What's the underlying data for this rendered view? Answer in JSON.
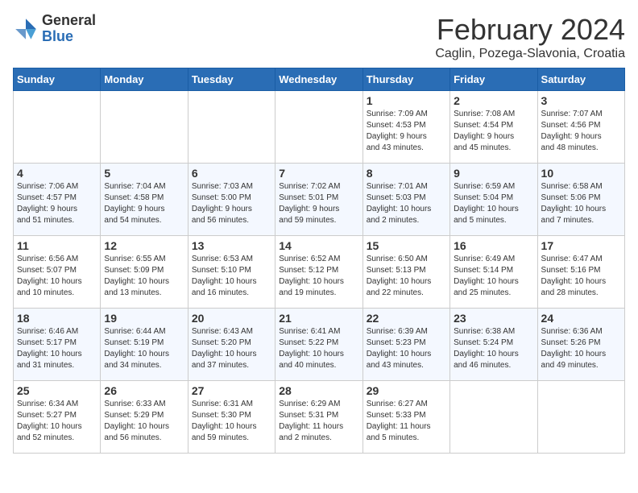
{
  "header": {
    "logo_general": "General",
    "logo_blue": "Blue",
    "month_year": "February 2024",
    "location": "Caglin, Pozega-Slavonia, Croatia"
  },
  "calendar": {
    "days_of_week": [
      "Sunday",
      "Monday",
      "Tuesday",
      "Wednesday",
      "Thursday",
      "Friday",
      "Saturday"
    ],
    "weeks": [
      [
        {
          "day": "",
          "info": ""
        },
        {
          "day": "",
          "info": ""
        },
        {
          "day": "",
          "info": ""
        },
        {
          "day": "",
          "info": ""
        },
        {
          "day": "1",
          "info": "Sunrise: 7:09 AM\nSunset: 4:53 PM\nDaylight: 9 hours\nand 43 minutes."
        },
        {
          "day": "2",
          "info": "Sunrise: 7:08 AM\nSunset: 4:54 PM\nDaylight: 9 hours\nand 45 minutes."
        },
        {
          "day": "3",
          "info": "Sunrise: 7:07 AM\nSunset: 4:56 PM\nDaylight: 9 hours\nand 48 minutes."
        }
      ],
      [
        {
          "day": "4",
          "info": "Sunrise: 7:06 AM\nSunset: 4:57 PM\nDaylight: 9 hours\nand 51 minutes."
        },
        {
          "day": "5",
          "info": "Sunrise: 7:04 AM\nSunset: 4:58 PM\nDaylight: 9 hours\nand 54 minutes."
        },
        {
          "day": "6",
          "info": "Sunrise: 7:03 AM\nSunset: 5:00 PM\nDaylight: 9 hours\nand 56 minutes."
        },
        {
          "day": "7",
          "info": "Sunrise: 7:02 AM\nSunset: 5:01 PM\nDaylight: 9 hours\nand 59 minutes."
        },
        {
          "day": "8",
          "info": "Sunrise: 7:01 AM\nSunset: 5:03 PM\nDaylight: 10 hours\nand 2 minutes."
        },
        {
          "day": "9",
          "info": "Sunrise: 6:59 AM\nSunset: 5:04 PM\nDaylight: 10 hours\nand 5 minutes."
        },
        {
          "day": "10",
          "info": "Sunrise: 6:58 AM\nSunset: 5:06 PM\nDaylight: 10 hours\nand 7 minutes."
        }
      ],
      [
        {
          "day": "11",
          "info": "Sunrise: 6:56 AM\nSunset: 5:07 PM\nDaylight: 10 hours\nand 10 minutes."
        },
        {
          "day": "12",
          "info": "Sunrise: 6:55 AM\nSunset: 5:09 PM\nDaylight: 10 hours\nand 13 minutes."
        },
        {
          "day": "13",
          "info": "Sunrise: 6:53 AM\nSunset: 5:10 PM\nDaylight: 10 hours\nand 16 minutes."
        },
        {
          "day": "14",
          "info": "Sunrise: 6:52 AM\nSunset: 5:12 PM\nDaylight: 10 hours\nand 19 minutes."
        },
        {
          "day": "15",
          "info": "Sunrise: 6:50 AM\nSunset: 5:13 PM\nDaylight: 10 hours\nand 22 minutes."
        },
        {
          "day": "16",
          "info": "Sunrise: 6:49 AM\nSunset: 5:14 PM\nDaylight: 10 hours\nand 25 minutes."
        },
        {
          "day": "17",
          "info": "Sunrise: 6:47 AM\nSunset: 5:16 PM\nDaylight: 10 hours\nand 28 minutes."
        }
      ],
      [
        {
          "day": "18",
          "info": "Sunrise: 6:46 AM\nSunset: 5:17 PM\nDaylight: 10 hours\nand 31 minutes."
        },
        {
          "day": "19",
          "info": "Sunrise: 6:44 AM\nSunset: 5:19 PM\nDaylight: 10 hours\nand 34 minutes."
        },
        {
          "day": "20",
          "info": "Sunrise: 6:43 AM\nSunset: 5:20 PM\nDaylight: 10 hours\nand 37 minutes."
        },
        {
          "day": "21",
          "info": "Sunrise: 6:41 AM\nSunset: 5:22 PM\nDaylight: 10 hours\nand 40 minutes."
        },
        {
          "day": "22",
          "info": "Sunrise: 6:39 AM\nSunset: 5:23 PM\nDaylight: 10 hours\nand 43 minutes."
        },
        {
          "day": "23",
          "info": "Sunrise: 6:38 AM\nSunset: 5:24 PM\nDaylight: 10 hours\nand 46 minutes."
        },
        {
          "day": "24",
          "info": "Sunrise: 6:36 AM\nSunset: 5:26 PM\nDaylight: 10 hours\nand 49 minutes."
        }
      ],
      [
        {
          "day": "25",
          "info": "Sunrise: 6:34 AM\nSunset: 5:27 PM\nDaylight: 10 hours\nand 52 minutes."
        },
        {
          "day": "26",
          "info": "Sunrise: 6:33 AM\nSunset: 5:29 PM\nDaylight: 10 hours\nand 56 minutes."
        },
        {
          "day": "27",
          "info": "Sunrise: 6:31 AM\nSunset: 5:30 PM\nDaylight: 10 hours\nand 59 minutes."
        },
        {
          "day": "28",
          "info": "Sunrise: 6:29 AM\nSunset: 5:31 PM\nDaylight: 11 hours\nand 2 minutes."
        },
        {
          "day": "29",
          "info": "Sunrise: 6:27 AM\nSunset: 5:33 PM\nDaylight: 11 hours\nand 5 minutes."
        },
        {
          "day": "",
          "info": ""
        },
        {
          "day": "",
          "info": ""
        }
      ]
    ]
  }
}
